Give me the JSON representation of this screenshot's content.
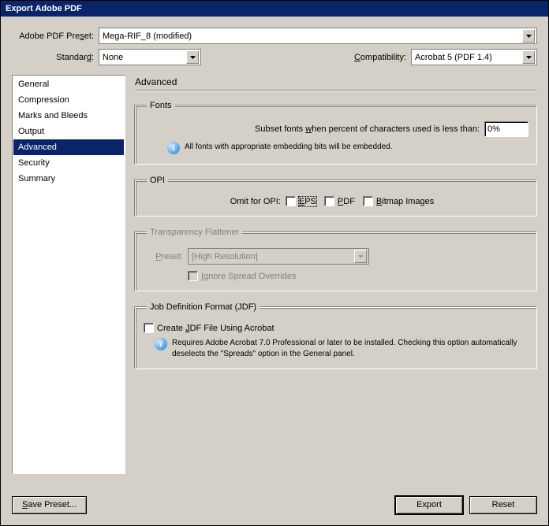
{
  "window_title": "Export Adobe PDF",
  "preset": {
    "label": "Adobe PDF Preset:",
    "accel": "",
    "value": "Mega-RIF_8 (modified)"
  },
  "standard": {
    "label": "Standard:",
    "accel": "S",
    "value": "None"
  },
  "compatibility": {
    "label": "Compatibility:",
    "accel": "C",
    "value": "Acrobat 5 (PDF 1.4)"
  },
  "sidebar": [
    {
      "label": "General"
    },
    {
      "label": "Compression"
    },
    {
      "label": "Marks and Bleeds"
    },
    {
      "label": "Output"
    },
    {
      "label": "Advanced",
      "selected": true
    },
    {
      "label": "Security"
    },
    {
      "label": "Summary"
    }
  ],
  "main_title": "Advanced",
  "fonts": {
    "legend": "Fonts",
    "subset_label_pre": "Subset fonts ",
    "subset_label_mid": "w",
    "subset_label_post": "hen percent of characters used is less than:",
    "value": "0%",
    "info": "All fonts with appropriate embedding bits will be embedded."
  },
  "opi": {
    "legend": "OPI",
    "label": "Omit for OPI:",
    "eps": "EPS",
    "eps_ak": "E",
    "pdf": "PDF",
    "pdf_ak": "P",
    "bitmap": "Bitmap Images",
    "bitmap_ak": "B"
  },
  "flattener": {
    "legend": "Transparency Flattener",
    "preset_label": "Preset:",
    "preset_ak": "P",
    "preset_value": "[High Resolution]",
    "ignore": "Ignore Spread Overrides",
    "ignore_ak": "I"
  },
  "jdf": {
    "legend": "Job Definition Format (JDF)",
    "create": "Create JDF File Using Acrobat",
    "create_ak": "J",
    "info": "Requires Adobe Acrobat 7.0 Professional or later to be installed. Checking this option automatically deselects the \"Spreads\" option in the General panel."
  },
  "buttons": {
    "save_preset": "Save Preset...",
    "save_ak": "S",
    "export": "Export",
    "reset": "Reset"
  }
}
